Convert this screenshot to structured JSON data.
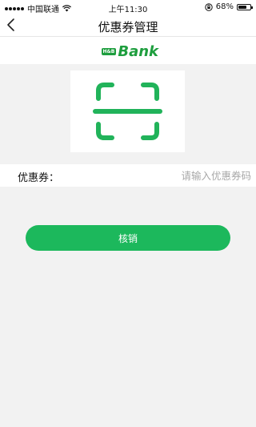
{
  "status_bar": {
    "carrier": "中国联通",
    "wifi_icon": "wifi-icon",
    "time": "上午11:30",
    "lock_icon": "orientation-lock-icon",
    "battery_percent": "68%",
    "battery_level": 0.68
  },
  "nav": {
    "back_icon": "chevron-left-icon",
    "title": "优惠券管理"
  },
  "logo": {
    "text": "Bank",
    "mini_text": "H&B",
    "icon": "sunflower-icon",
    "brand_color": "#1e9e3e"
  },
  "scan": {
    "icon": "qr-scan-icon",
    "color": "#21b35a"
  },
  "coupon": {
    "label": "优惠券：",
    "placeholder": "请输入优惠券码",
    "value": ""
  },
  "actions": {
    "verify_label": "核销",
    "accent_color": "#1cb85c"
  }
}
